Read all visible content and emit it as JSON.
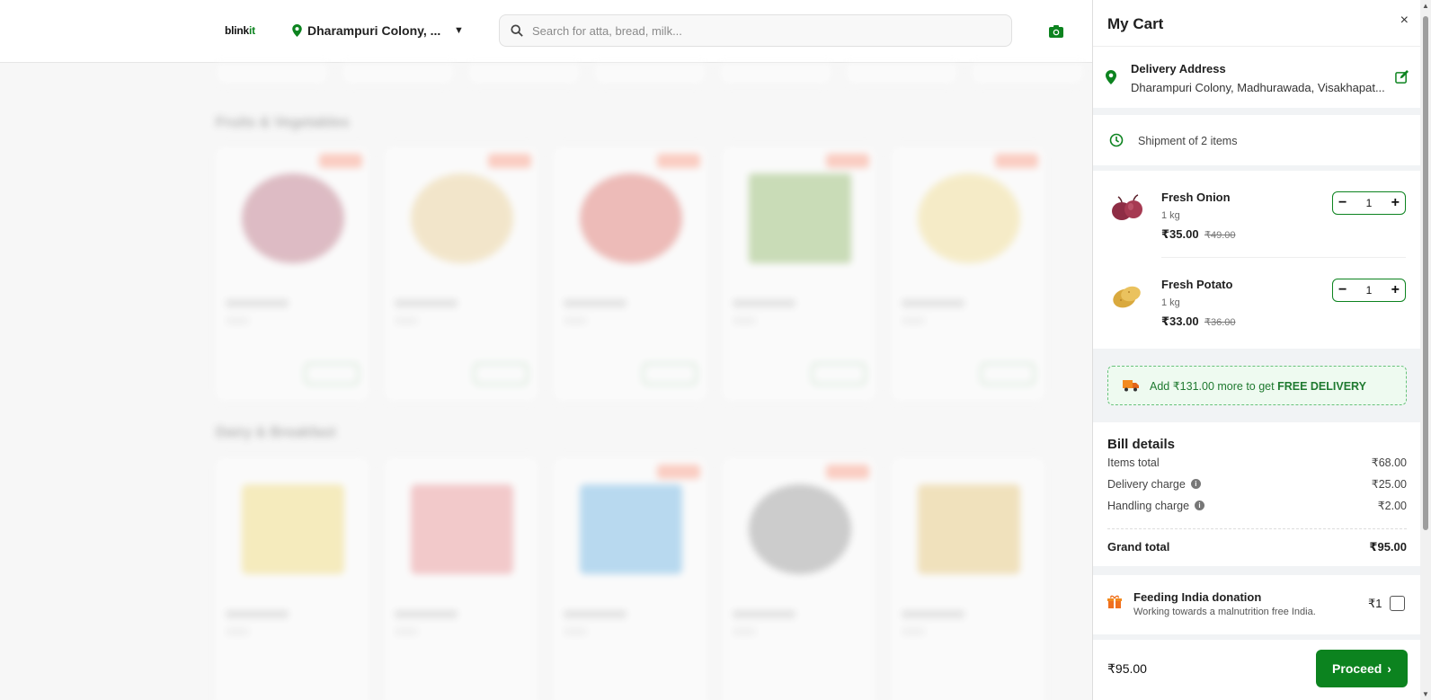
{
  "header": {
    "logo_main": "blink",
    "logo_accent": "it",
    "location": "Dharampuri Colony, ...",
    "location_caret": "▼",
    "search_placeholder": "Search for atta, bread, milk..."
  },
  "background": {
    "section_fruits": "Fruits & Vegetables",
    "section_dairy": "Dairy & Breakfast"
  },
  "cart": {
    "title": "My Cart",
    "close": "×",
    "delivery_address_title": "Delivery Address",
    "delivery_address": "Dharampuri Colony, Madhurawada, Visakhapat...",
    "shipment": "Shipment of 2 items",
    "items": [
      {
        "name": "Fresh Onion",
        "qty": "1 kg",
        "price": "₹35.00",
        "mrp": "₹49.00",
        "count": "1"
      },
      {
        "name": "Fresh Potato",
        "qty": "1 kg",
        "price": "₹33.00",
        "mrp": "₹36.00",
        "count": "1"
      }
    ],
    "stepper_minus": "−",
    "stepper_plus": "+",
    "free_delivery_prefix": "Add ₹131.00 more to get",
    "free_delivery_bold": "FREE DELIVERY",
    "bill": {
      "title": "Bill details",
      "items_total_label": "Items total",
      "items_total": "₹68.00",
      "delivery_label": "Delivery charge",
      "delivery": "₹25.00",
      "handling_label": "Handling charge",
      "handling": "₹2.00",
      "grand_label": "Grand total",
      "grand": "₹95.00"
    },
    "donation": {
      "title": "Feeding India donation",
      "subtitle": "Working towards a malnutrition free India.",
      "amount": "₹1"
    },
    "footer_total": "₹95.00",
    "proceed": "Proceed",
    "proceed_arrow": "›"
  },
  "colors": {
    "brand_green": "#0c831f",
    "free_delivery_bg": "#eefaf0",
    "offer_tag": "#ff7a59"
  }
}
